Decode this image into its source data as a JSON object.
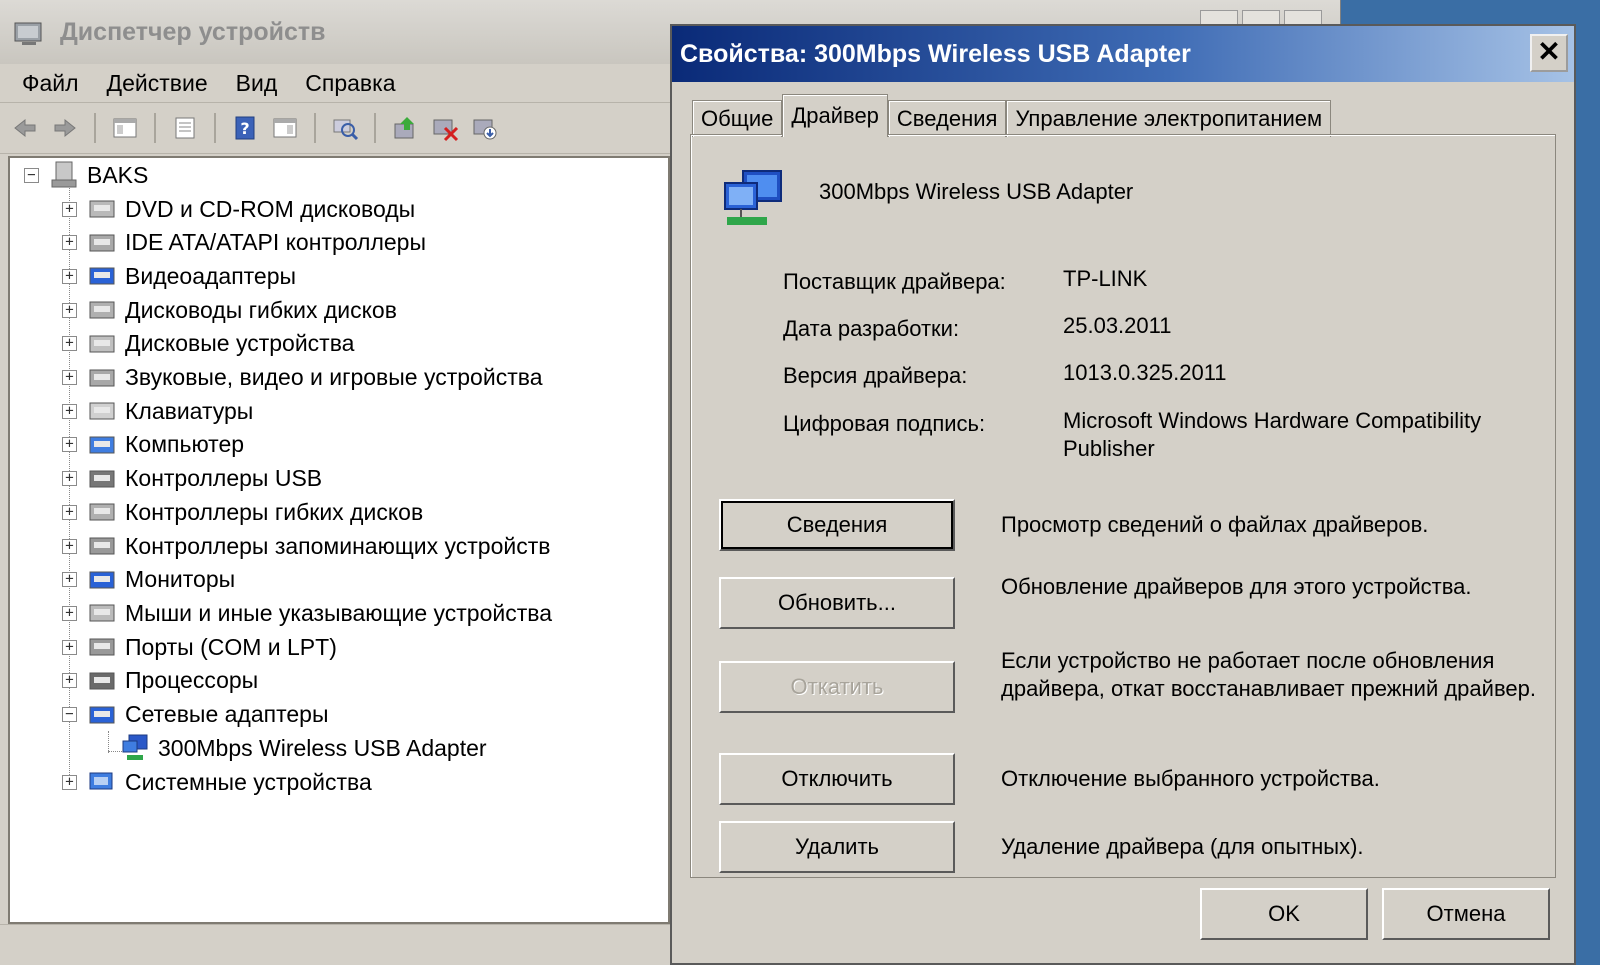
{
  "main_window": {
    "title": "Диспетчер устройств",
    "menu": [
      "Файл",
      "Действие",
      "Вид",
      "Справка"
    ],
    "tree": {
      "root": "BAKS",
      "categories": [
        "DVD и CD-ROM дисководы",
        "IDE ATA/ATAPI контроллеры",
        "Видеоадаптеры",
        "Дисководы гибких дисков",
        "Дисковые устройства",
        "Звуковые, видео и игровые устройства",
        "Клавиатуры",
        "Компьютер",
        "Контроллеры USB",
        "Контроллеры гибких дисков",
        "Контроллеры запоминающих устройств",
        "Мониторы",
        "Мыши и иные указывающие устройства",
        "Порты (COM и LPT)",
        "Процессоры",
        "Сетевые адаптеры"
      ],
      "expanded_child": "300Mbps Wireless USB Adapter",
      "last_category": "Системные устройства"
    }
  },
  "dialog": {
    "title": "Свойства: 300Mbps Wireless USB Adapter",
    "close_glyph": "✕",
    "tabs": [
      "Общие",
      "Драйвер",
      "Сведения",
      "Управление электропитанием"
    ],
    "active_tab": "Драйвер",
    "device_name": "300Mbps Wireless USB Adapter",
    "properties": {
      "provider_label": "Поставщик драйвера:",
      "provider_value": "TP-LINK",
      "date_label": "Дата разработки:",
      "date_value": "25.03.2011",
      "version_label": "Версия драйвера:",
      "version_value": "1013.0.325.2011",
      "signature_label": "Цифровая подпись:",
      "signature_value": "Microsoft Windows Hardware Compatibility Publisher"
    },
    "actions": [
      {
        "label": "Сведения",
        "desc": "Просмотр сведений о файлах драйверов."
      },
      {
        "label": "Обновить...",
        "desc": "Обновление драйверов для этого устройства."
      },
      {
        "label": "Откатить",
        "desc": "Если устройство не работает после обновления драйвера, откат восстанавливает прежний драйвер."
      },
      {
        "label": "Отключить",
        "desc": "Отключение выбранного устройства."
      },
      {
        "label": "Удалить",
        "desc": "Удаление драйвера (для опытных)."
      }
    ],
    "ok_label": "OK",
    "cancel_label": "Отмена"
  }
}
